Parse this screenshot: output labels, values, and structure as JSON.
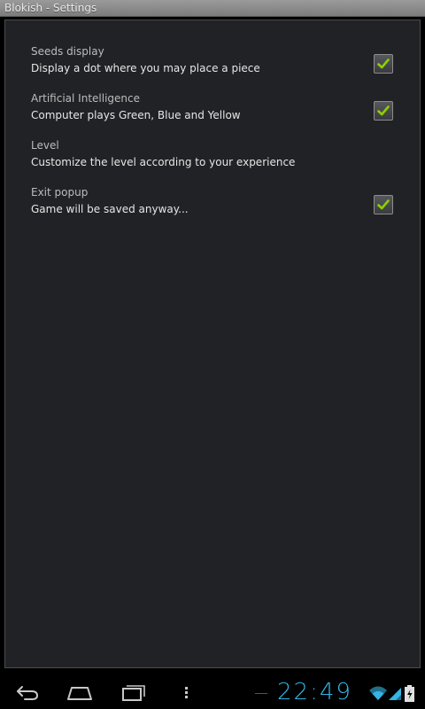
{
  "window": {
    "title": "Blokish - Settings"
  },
  "preferences": [
    {
      "title": "Seeds display",
      "summary": "Display a dot where you may place a piece",
      "has_checkbox": true,
      "checked": true
    },
    {
      "title": "Artificial Intelligence",
      "summary": "Computer plays Green, Blue and Yellow",
      "has_checkbox": true,
      "checked": true
    },
    {
      "title": "Level",
      "summary": "Customize the level according to your experience",
      "has_checkbox": false,
      "checked": false
    },
    {
      "title": "Exit popup",
      "summary": "Game will be saved anyway...",
      "has_checkbox": true,
      "checked": true
    }
  ],
  "system_bar": {
    "clock": "22:49",
    "icons": [
      "back-icon",
      "home-icon",
      "recent-apps-icon",
      "menu-icon",
      "wifi-icon",
      "signal-icon",
      "battery-icon"
    ]
  },
  "colors": {
    "accent": "#33b5e5",
    "check": "#8bd100",
    "panel_bg": "#212226"
  }
}
